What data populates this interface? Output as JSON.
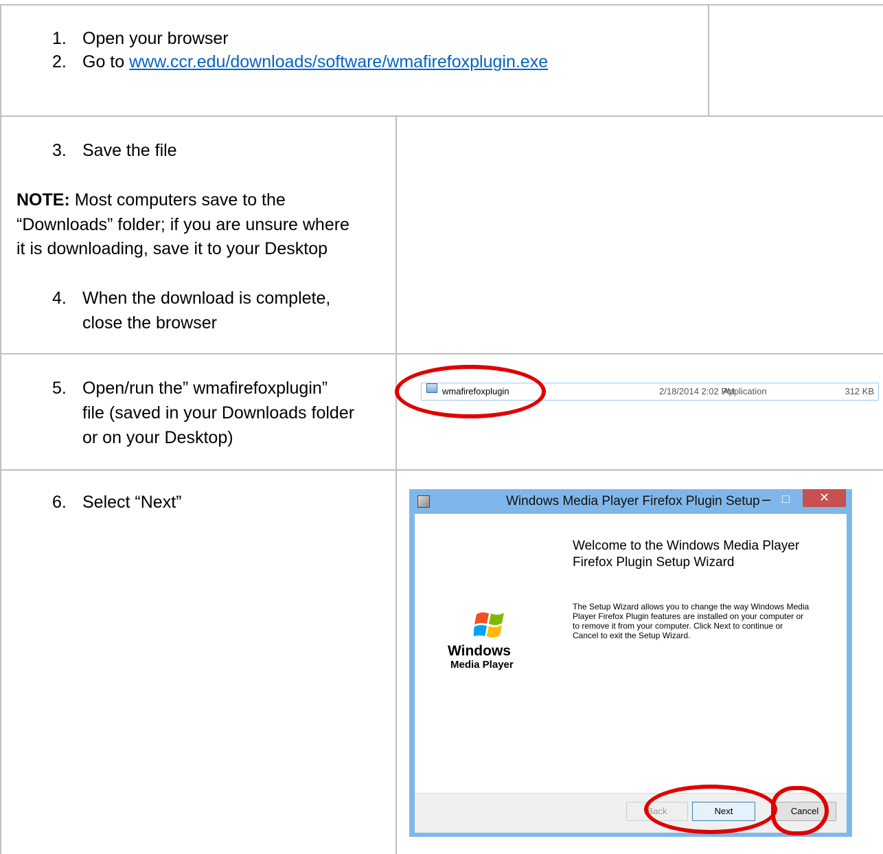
{
  "steps": {
    "step1": {
      "number": "1.",
      "text": "Open your browser"
    },
    "step2": {
      "number": "2.",
      "prefix": "Go to ",
      "link": "www.ccr.edu/downloads/software/wmafirefoxplugin.exe"
    },
    "step3": {
      "number": "3.",
      "text": "Save the file"
    },
    "note": {
      "label": "NOTE:",
      "line1": " Most computers save to the",
      "line2": "“Downloads” folder; if you are unsure where",
      "line3": "it is downloading, save it to your Desktop"
    },
    "step4": {
      "number": "4.",
      "line1": "When the download is complete,",
      "line2": "close the browser"
    },
    "step5": {
      "number": "5.",
      "line1": "Open/run the” wmafirefoxplugin”",
      "line2": "file (saved in your Downloads folder",
      "line3": "or on your Desktop)"
    },
    "step6": {
      "number": "6.",
      "text": "Select “Next”"
    }
  },
  "file_row": {
    "name": "wmafirefoxplugin",
    "date": "2/18/2014 2:02 PM",
    "type": "Application",
    "size": "312 KB"
  },
  "dialog": {
    "title": "Windows Media Player Firefox Plugin Setup",
    "heading_line1": "Welcome to the Windows Media Player",
    "heading_line2": "Firefox Plugin Setup Wizard",
    "body_line1": "The Setup Wizard allows you to change the way Windows Media",
    "body_line2": "Player Firefox Plugin features are installed on your computer or",
    "body_line3": "to remove it from your computer. Click Next to continue or",
    "body_line4": "Cancel to exit the Setup Wizard.",
    "logo_line1": "Windows",
    "logo_line2": "Media Player",
    "back_label": "Back",
    "next_label": "Next",
    "cancel_label": "Cancel",
    "close_glyph": "✕",
    "minimize_glyph": "–",
    "maximize_glyph": "□"
  },
  "colors": {
    "highlight": "#e00000",
    "link": "#0563c1",
    "dialog_frame": "#80b7ea"
  }
}
